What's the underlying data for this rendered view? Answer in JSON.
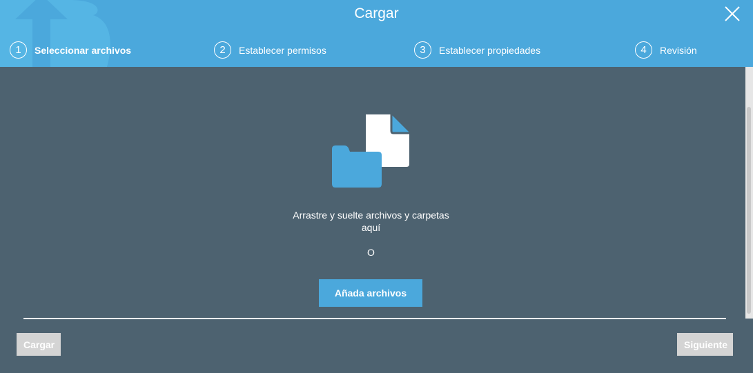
{
  "header": {
    "title": "Cargar",
    "steps": [
      {
        "num": "1",
        "label": "Seleccionar archivos"
      },
      {
        "num": "2",
        "label": "Establecer permisos"
      },
      {
        "num": "3",
        "label": "Establecer propiedades"
      },
      {
        "num": "4",
        "label": "Revisión"
      }
    ]
  },
  "main": {
    "drop_text_1": "Arrastre y suelte archivos y carpetas",
    "drop_text_2": "aquí",
    "or": "O",
    "add_label": "Añada archivos"
  },
  "footer": {
    "upload_label": "Cargar",
    "next_label": "Siguiente"
  },
  "colors": {
    "accent": "#4ba8dc",
    "background": "#4d6270"
  }
}
